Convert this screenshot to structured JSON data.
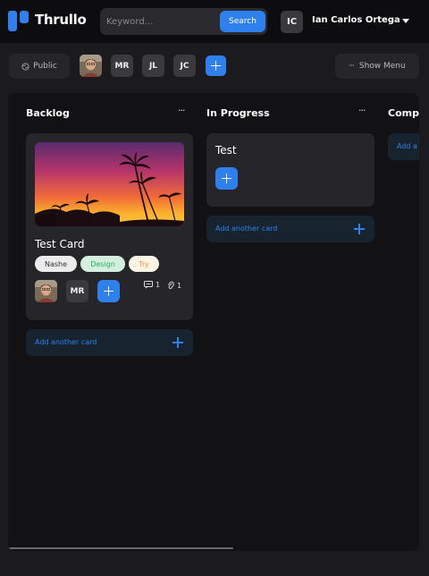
{
  "app": {
    "name": "Thrullo"
  },
  "search": {
    "placeholder": "Keyword...",
    "button_label": "Search"
  },
  "user": {
    "initials": "IC",
    "name": "Ian Carlos Ortega"
  },
  "toolbar": {
    "visibility_label": "Public",
    "members": [
      "MR",
      "JL",
      "JC"
    ],
    "show_menu_label": "Show Menu",
    "show_menu_icon": "···"
  },
  "lists": [
    {
      "title": "Backlog",
      "more_icon": "···",
      "cards": [
        {
          "title": "Test Card",
          "labels": [
            {
              "text": "Nashe",
              "bg": "#ececec",
              "fg": "#333333"
            },
            {
              "text": "Design",
              "bg": "#d5efdf",
              "fg": "#27ae60"
            },
            {
              "text": "Try",
              "bg": "#fdf4e3",
              "fg": "#f2994a"
            }
          ],
          "members": [
            "MR"
          ],
          "comments": "1",
          "attachments": "1"
        }
      ],
      "add_card_label": "Add another card"
    },
    {
      "title": "In Progress",
      "more_icon": "···",
      "cards": [
        {
          "title": "Test"
        }
      ],
      "add_card_label": "Add another card"
    },
    {
      "title": "Comp",
      "add_card_label": "Add a"
    }
  ],
  "colors": {
    "accent": "#2f80ed",
    "background": "#1b1b1f",
    "board": "#121214",
    "card": "#25252a"
  }
}
